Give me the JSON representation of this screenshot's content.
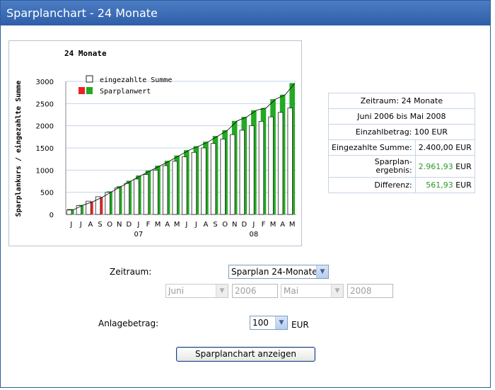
{
  "window": {
    "title": "Sparplanchart - 24 Monate"
  },
  "chart_data": {
    "type": "bar",
    "title": "24 Monate",
    "xlabel": "",
    "ylabel": "Sparplankurs / eingezahlte Summe",
    "ylim": [
      0,
      3000
    ],
    "yticks": [
      0,
      500,
      1000,
      1500,
      2000,
      2500,
      3000
    ],
    "categories": [
      "J",
      "J",
      "A",
      "S",
      "O",
      "N",
      "D",
      "J",
      "F",
      "M",
      "A",
      "M",
      "J",
      "J",
      "A",
      "S",
      "O",
      "N",
      "D",
      "J",
      "F",
      "M",
      "A",
      "M"
    ],
    "year_labels": [
      {
        "label": "07",
        "index": 7
      },
      {
        "label": "08",
        "index": 19
      }
    ],
    "grid": true,
    "legend": "top-left",
    "series": [
      {
        "name": "eingezahlte Summe",
        "color": "#ffffff",
        "values": [
          100,
          200,
          300,
          400,
          500,
          600,
          700,
          800,
          900,
          1000,
          1100,
          1200,
          1300,
          1400,
          1500,
          1600,
          1700,
          1800,
          1900,
          2000,
          2100,
          2200,
          2300,
          2400
        ]
      },
      {
        "name": "Sparplanwert",
        "color": "#22aa22",
        "negative_color": "#ee2222",
        "values": [
          110,
          215,
          290,
          395,
          520,
          640,
          760,
          880,
          990,
          1100,
          1210,
          1330,
          1450,
          1540,
          1640,
          1770,
          1900,
          2110,
          2200,
          2350,
          2400,
          2600,
          2700,
          2962
        ]
      }
    ]
  },
  "info": {
    "zeitraum": "Zeitraum: 24 Monate",
    "periode": "Juni 2006 bis Mai 2008",
    "einzahlbetrag": "Einzahlbetrag: 100 EUR",
    "eingezahlt_label": "Eingezahlte Summe:",
    "eingezahlt_value": "2.400,00 EUR",
    "ergebnis_label_1": "Sparplan-",
    "ergebnis_label_2": "ergebnis:",
    "ergebnis_value": "2.961,93",
    "ergebnis_unit": "EUR",
    "differenz_label": "Differenz:",
    "differenz_value": "561,93",
    "differenz_unit": "EUR",
    "positive_color": "#2a9a2a"
  },
  "form": {
    "zeitraum_label": "Zeitraum:",
    "zeitraum_value": "Sparplan 24-Monate",
    "start_month": "Juni",
    "start_year": "2006",
    "end_month": "Mai",
    "end_year": "2008",
    "anlage_label": "Anlagebetrag:",
    "anlage_value": "100",
    "anlage_unit": "EUR",
    "submit_label": "Sparplanchart anzeigen"
  }
}
